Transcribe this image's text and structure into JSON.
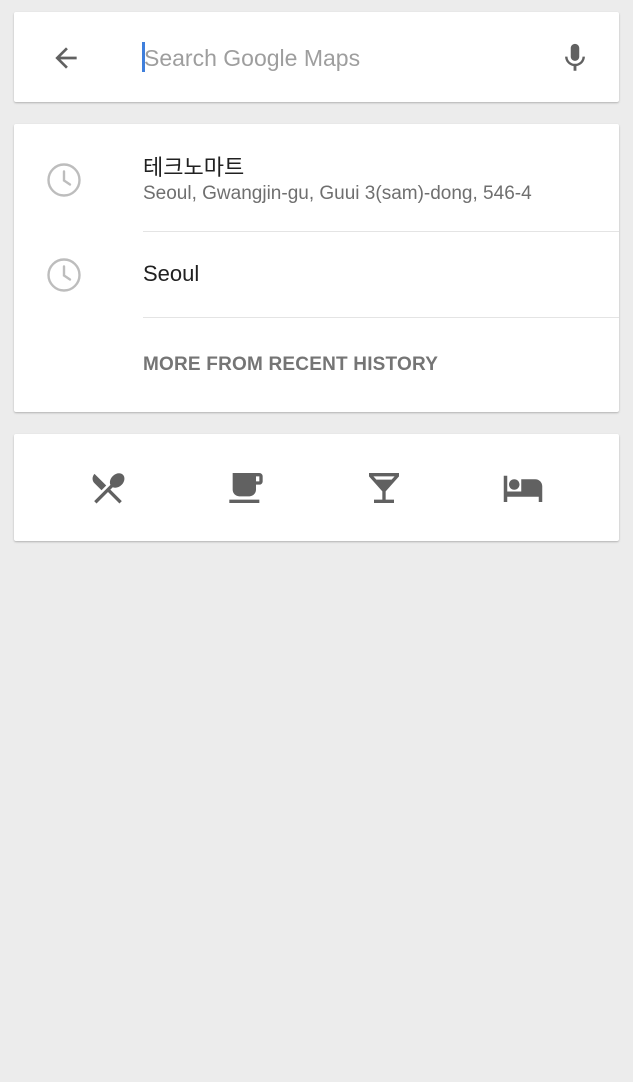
{
  "search": {
    "placeholder": "Search Google Maps",
    "value": "",
    "back_icon": "arrow-back-icon",
    "mic_icon": "microphone-icon"
  },
  "history": {
    "items": [
      {
        "icon": "clock-icon",
        "title": "테크노마트",
        "subtitle": "Seoul, Gwangjin-gu, Guui 3(sam)-dong, 546-4"
      },
      {
        "icon": "clock-icon",
        "title": "Seoul",
        "subtitle": ""
      }
    ],
    "more_label": "MORE FROM RECENT HISTORY"
  },
  "categories": [
    {
      "icon": "restaurant-icon"
    },
    {
      "icon": "coffee-icon"
    },
    {
      "icon": "cocktail-icon"
    },
    {
      "icon": "hotel-icon"
    }
  ],
  "colors": {
    "background": "#ececec",
    "card": "#ffffff",
    "icon_dark": "#616161",
    "icon_light": "#bdbdbd",
    "caret": "#3f7fdc",
    "text_primary": "#212121",
    "text_secondary": "#6f6f6f"
  }
}
